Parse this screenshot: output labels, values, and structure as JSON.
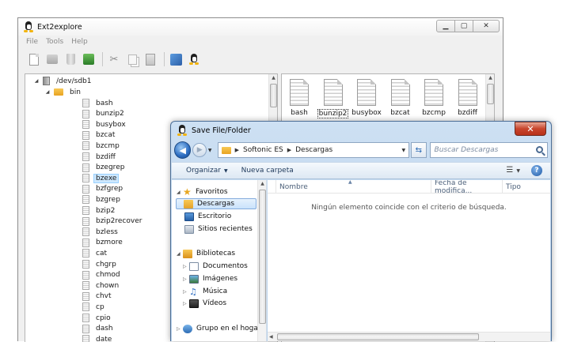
{
  "main_window": {
    "title": "Ext2explore",
    "menu": [
      "File",
      "Tools",
      "Help"
    ],
    "tree": {
      "device": "/dev/sdb1",
      "folder": "bin",
      "files": [
        "bash",
        "bunzip2",
        "busybox",
        "bzcat",
        "bzcmp",
        "bzdiff",
        "bzegrep",
        "bzexe",
        "bzfgrep",
        "bzgrep",
        "bzip2",
        "bzip2recover",
        "bzless",
        "bzmore",
        "cat",
        "chgrp",
        "chmod",
        "chown",
        "chvt",
        "cp",
        "cpio",
        "dash",
        "date"
      ],
      "selected": "bzexe"
    },
    "icon_files": [
      "bash",
      "bunzip2",
      "busybox",
      "bzcat",
      "bzcmp",
      "bzdiff"
    ],
    "icon_selected": "bunzip2"
  },
  "dialog": {
    "title": "Save File/Folder",
    "breadcrumb": [
      "Softonic ES",
      "Descargas"
    ],
    "search_placeholder": "Buscar Descargas",
    "commands": {
      "organize": "Organizar",
      "new_folder": "Nueva carpeta"
    },
    "nav": {
      "favorites_header": "Favoritos",
      "favorites": [
        "Descargas",
        "Escritorio",
        "Sitios recientes"
      ],
      "libraries_header": "Bibliotecas",
      "libraries": [
        "Documentos",
        "Imágenes",
        "Música",
        "Vídeos"
      ],
      "homegroup": "Grupo en el hogar"
    },
    "columns": {
      "name": "Nombre",
      "date": "Fecha de modifica...",
      "type": "Tipo"
    },
    "empty_message": "Ningún elemento coincide con el criterio de búsqueda."
  }
}
